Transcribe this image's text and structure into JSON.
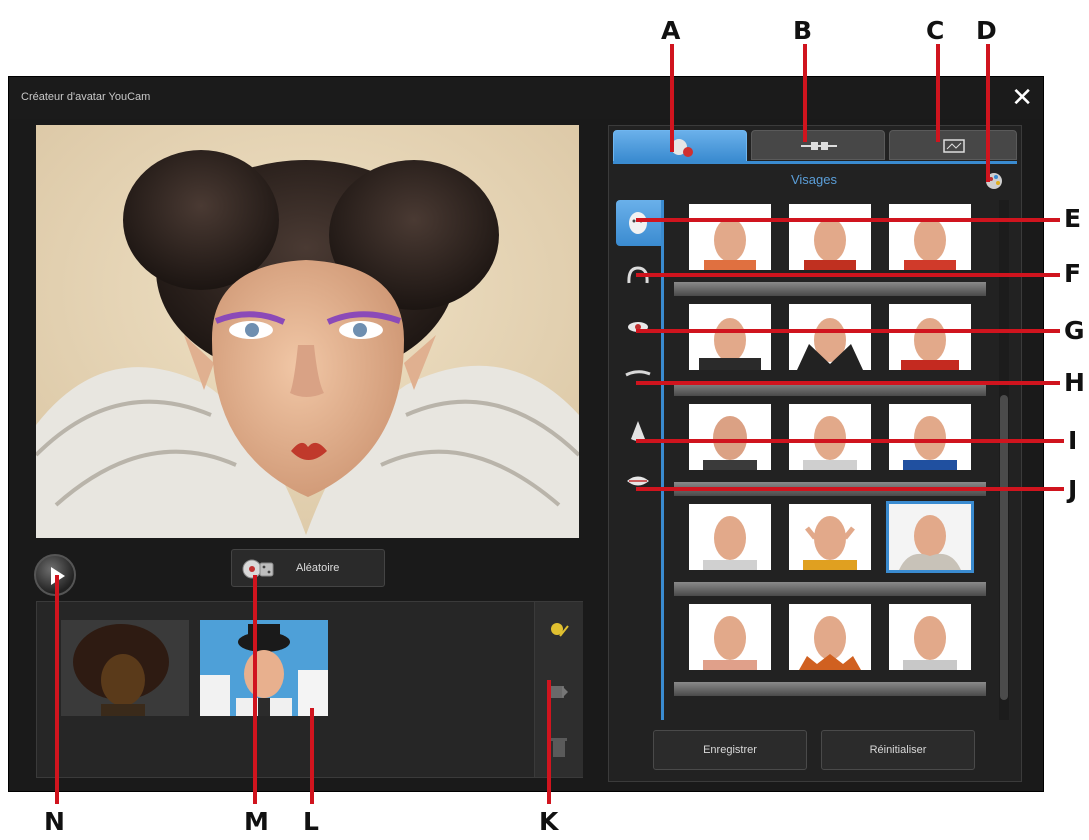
{
  "window": {
    "title": "Créateur d'avatar YouCam",
    "close_glyph": "✕"
  },
  "toolbar": {
    "random_label": "Aléatoire"
  },
  "panel": {
    "section_title": "Visages",
    "tabs": [
      {
        "name": "face-editor-tab",
        "icon": "face-edit-icon",
        "active": true
      },
      {
        "name": "accessories-tab",
        "icon": "accessories-icon",
        "active": false
      },
      {
        "name": "background-tab",
        "icon": "background-icon",
        "active": false
      }
    ],
    "categories": [
      {
        "name": "faces",
        "icon": "face-icon"
      },
      {
        "name": "hair",
        "icon": "hair-icon"
      },
      {
        "name": "eyes",
        "icon": "eye-icon"
      },
      {
        "name": "eyebrows",
        "icon": "eyebrow-icon"
      },
      {
        "name": "nose",
        "icon": "nose-icon"
      },
      {
        "name": "mouth",
        "icon": "mouth-icon"
      }
    ],
    "selected_face_row": 4,
    "selected_face_col": 3,
    "save_label": "Enregistrer",
    "reset_label": "Réinitialiser"
  },
  "callouts": {
    "A": "A",
    "B": "B",
    "C": "C",
    "D": "D",
    "E": "E",
    "F": "F",
    "G": "G",
    "H": "H",
    "I": "I",
    "J": "J",
    "K": "K",
    "L": "L",
    "M": "M",
    "N": "N"
  },
  "colors": {
    "accent": "#3a8bd0",
    "callout_line": "#d0141e",
    "window_bg": "#1a1a1a"
  }
}
